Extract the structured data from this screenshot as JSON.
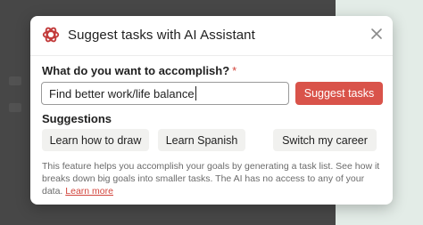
{
  "dialog": {
    "title": "Suggest tasks with AI Assistant",
    "logo_icon": "ai-assistant-logo-icon",
    "close_icon": "close-icon",
    "question_label": "What do you want to accomplish?",
    "required_marker": "*",
    "input_value": "Find better work/life balance",
    "suggest_button": "Suggest tasks",
    "suggestions_heading": "Suggestions",
    "suggestions": [
      "Learn how to draw",
      "Learn Spanish",
      "Switch my career"
    ],
    "note_text": "This feature helps you accomplish your goals by generating a task list. See how it breaks down big goals into smaller tasks. The AI has no access to any of your data.",
    "learn_more": "Learn more"
  },
  "colors": {
    "accent": "#d9534a",
    "logo": "#c23b3b",
    "chip_bg": "#f1f1ef",
    "backdrop": "#474747",
    "side_panel": "#e3ece7"
  }
}
